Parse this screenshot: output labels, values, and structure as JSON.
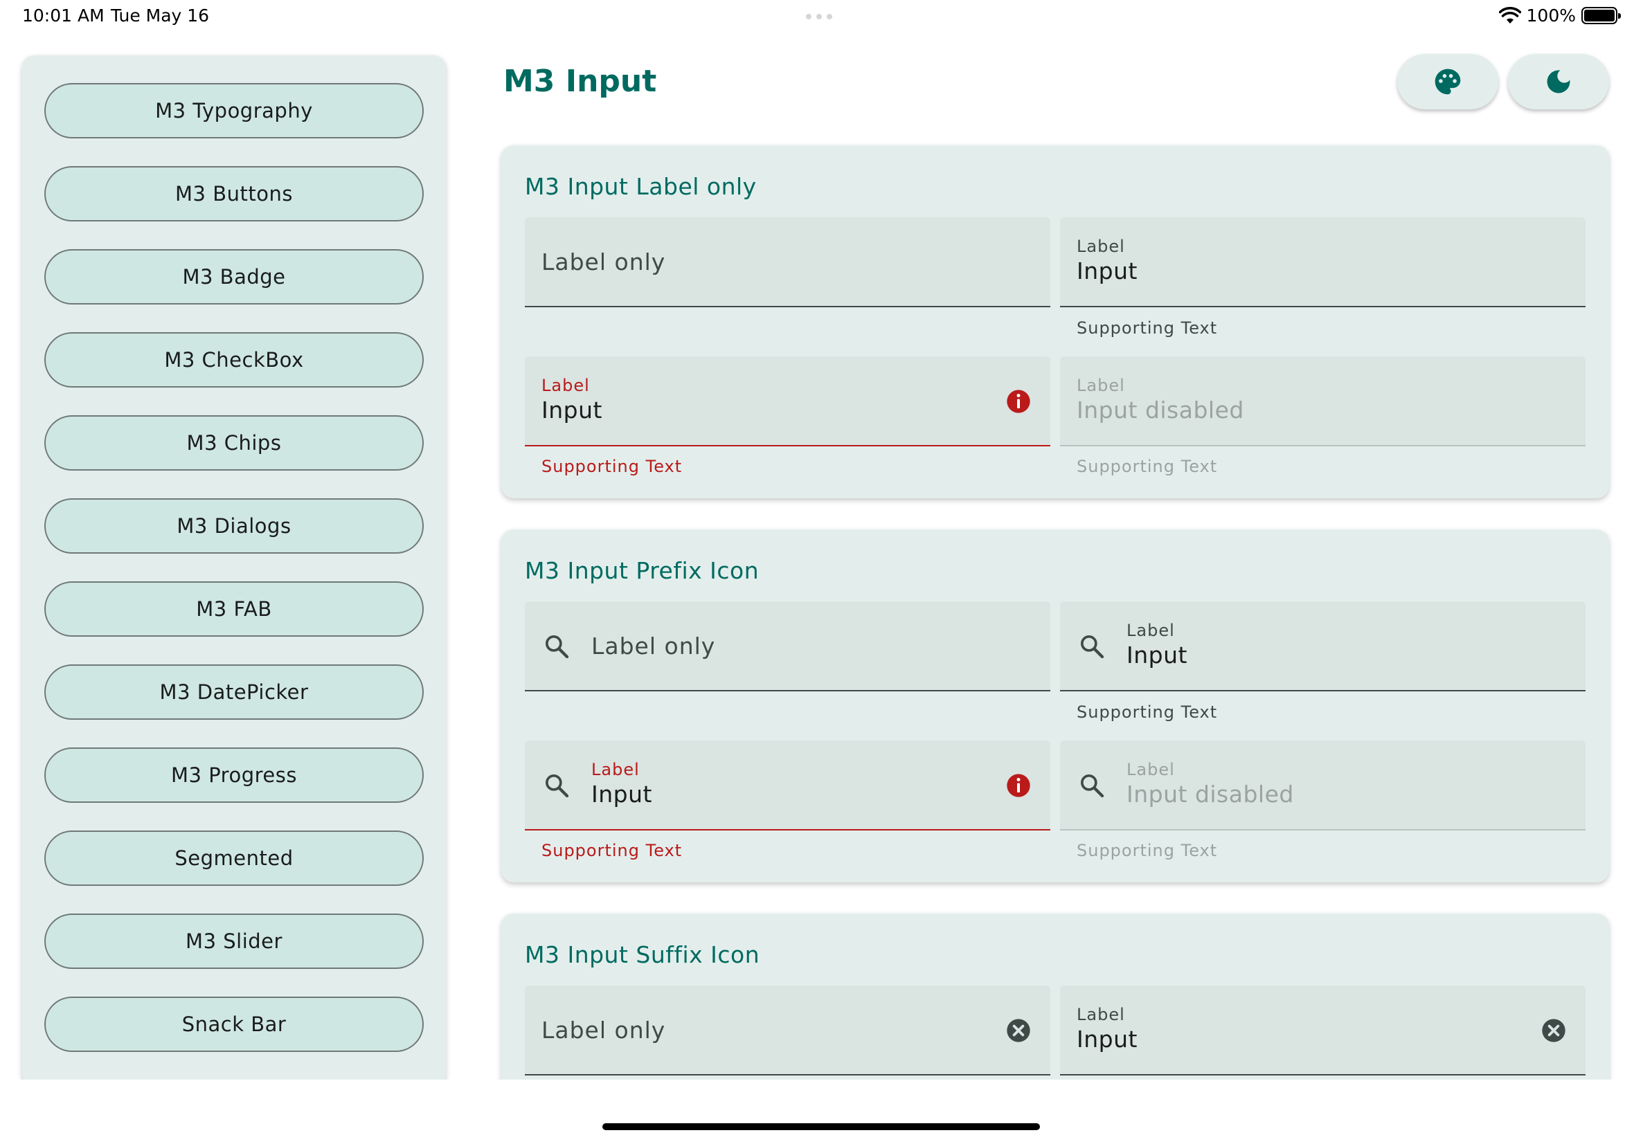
{
  "status_bar": {
    "time": "10:01 AM",
    "date": "Tue May 16",
    "battery": "100%"
  },
  "sidebar": {
    "items": [
      {
        "label": "M3 Typography"
      },
      {
        "label": "M3 Buttons"
      },
      {
        "label": "M3 Badge"
      },
      {
        "label": "M3 CheckBox"
      },
      {
        "label": "M3 Chips"
      },
      {
        "label": "M3 Dialogs"
      },
      {
        "label": "M3 FAB"
      },
      {
        "label": "M3 DatePicker"
      },
      {
        "label": "M3 Progress"
      },
      {
        "label": "Segmented"
      },
      {
        "label": "M3 Slider"
      },
      {
        "label": "Snack Bar"
      }
    ]
  },
  "header": {
    "title": "M3 Input",
    "actions": [
      {
        "icon": "palette-icon"
      },
      {
        "icon": "dark-mode-moon-icon"
      }
    ]
  },
  "colors": {
    "primary": "#006a60",
    "error": "#ba1a1a",
    "surface": "#e3eeec",
    "field_fill": "#dae4e1",
    "nav_button": "#cfe7e2"
  },
  "cards": [
    {
      "title": "M3 Input Label only",
      "fields": [
        {
          "label_only": "Label only"
        },
        {
          "label": "Label",
          "value": "Input",
          "supporting": "Supporting Text"
        },
        {
          "label": "Label",
          "value": "Input",
          "supporting": "Supporting Text",
          "state": "error"
        },
        {
          "label": "Label",
          "value": "Input disabled",
          "supporting": "Supporting Text",
          "state": "disabled"
        }
      ]
    },
    {
      "title": "M3 Input Prefix Icon",
      "fields": [
        {
          "label_only": "Label only",
          "prefix_icon": "search-icon"
        },
        {
          "label": "Label",
          "value": "Input",
          "supporting": "Supporting Text",
          "prefix_icon": "search-icon"
        },
        {
          "label": "Label",
          "value": "Input",
          "supporting": "Supporting Text",
          "state": "error",
          "prefix_icon": "search-icon"
        },
        {
          "label": "Label",
          "value": "Input disabled",
          "supporting": "Supporting Text",
          "state": "disabled",
          "prefix_icon": "search-icon"
        }
      ]
    },
    {
      "title": "M3 Input Suffix Icon",
      "fields": [
        {
          "label_only": "Label only",
          "suffix_icon": "clear-icon"
        },
        {
          "label": "Label",
          "value": "Input",
          "suffix_icon": "clear-icon"
        }
      ]
    }
  ]
}
